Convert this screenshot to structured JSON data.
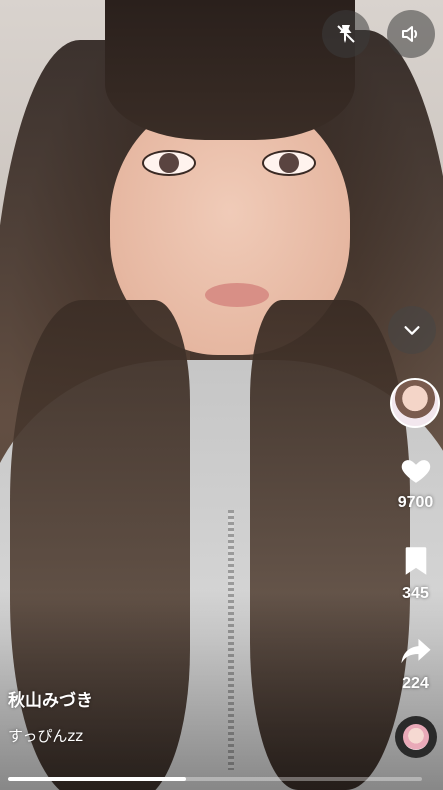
{
  "video": {
    "author": "秋山みづき",
    "caption": "すっぴんzz",
    "progress_fraction": 0.43
  },
  "controls": {
    "top": [
      {
        "icon": "pin-slash-icon"
      },
      {
        "icon": "volume-icon"
      }
    ],
    "collapse_icon": "chevron-down-icon"
  },
  "actions": {
    "likes": "9700",
    "saves": "345",
    "shares": "224"
  },
  "colors": {
    "icon": "#ffffff",
    "progress_track": "rgba(255,255,255,0.35)",
    "progress_fill": "#ffffff"
  }
}
